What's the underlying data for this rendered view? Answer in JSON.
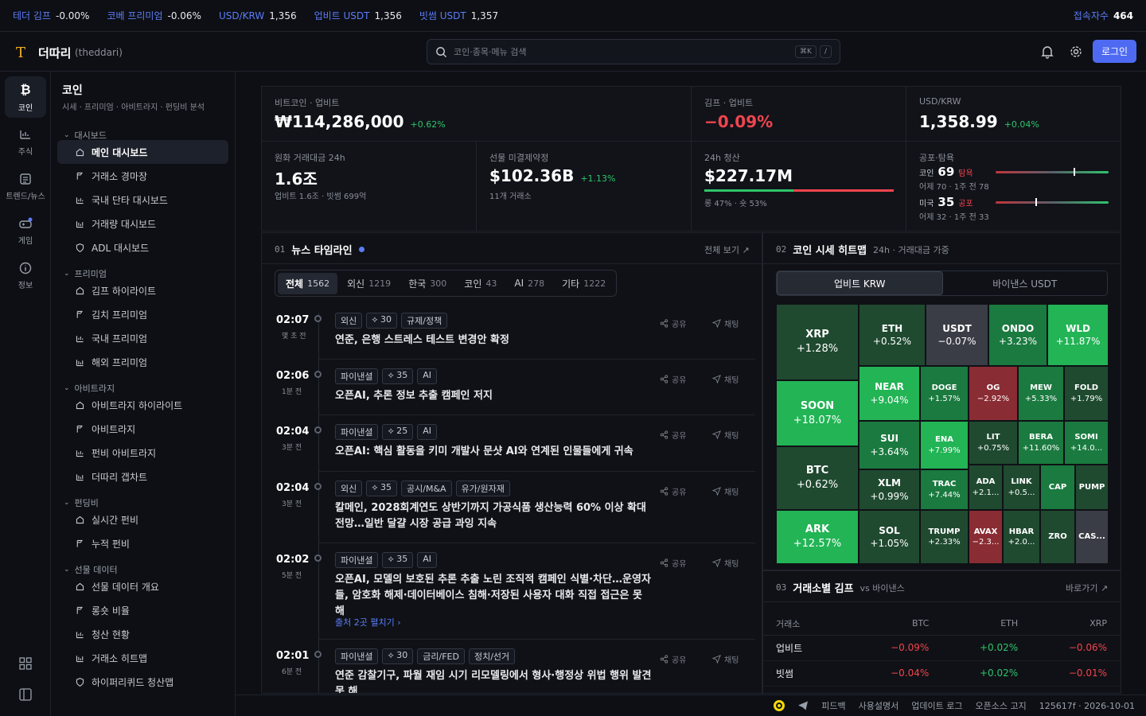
{
  "ticker": [
    {
      "label": "테더 김프",
      "value": "-0.00%"
    },
    {
      "label": "코베 프리미엄",
      "value": "-0.06%"
    },
    {
      "label": "USD/KRW",
      "value": "1,356"
    },
    {
      "label": "업비트 USDT",
      "value": "1,356"
    },
    {
      "label": "빗썸 USDT",
      "value": "1,357"
    }
  ],
  "online": {
    "label": "접속자수",
    "value": "464"
  },
  "header": {
    "logo": "T",
    "brand": "더따리",
    "brand_sub": "(theddari)",
    "search_placeholder": "코인·종목·메뉴 검색",
    "kbd1": "⌘K",
    "kbd2": "/",
    "login": "로그인"
  },
  "rail": [
    {
      "label": "코인",
      "icon": "bitcoin-icon"
    },
    {
      "label": "주식",
      "icon": "stock-icon"
    },
    {
      "label": "트렌드/뉴스",
      "icon": "news-icon"
    },
    {
      "label": "게임",
      "icon": "gamepad-icon"
    },
    {
      "label": "정보",
      "icon": "info-icon"
    }
  ],
  "sidebar": {
    "title": "코인",
    "subtitle": "시세 · 프리미엄 · 아비트라지 · 펀딩비 분석",
    "groups": [
      {
        "label": "대시보드",
        "items": [
          "메인 대시보드",
          "거래소 경마장",
          "국내 단타 대시보드",
          "거래량 대시보드",
          "ADL 대시보드"
        ]
      },
      {
        "label": "프리미엄",
        "items": [
          "김프 하이라이트",
          "김치 프리미엄",
          "국내 프리미엄",
          "해외 프리미엄"
        ]
      },
      {
        "label": "아비트라지",
        "items": [
          "아비트라지 하이라이트",
          "아비트라지",
          "펀비 아비트라지",
          "더따리 갭차트"
        ]
      },
      {
        "label": "펀딩비",
        "items": [
          "실시간 펀비",
          "누적 펀비"
        ]
      },
      {
        "label": "선물 데이터",
        "items": [
          "선물 데이터 개요",
          "롱숏 비율",
          "청산 현황",
          "거래소 히트맵",
          "하이퍼리퀴드 청산맵"
        ]
      }
    ]
  },
  "stats": {
    "btc": {
      "label": "비트코인 · 업비트",
      "value": "₩114,286,000",
      "change": "+0.62%"
    },
    "kimp": {
      "label": "김프 · 업비트",
      "value": "−0.09%"
    },
    "usdkrw": {
      "label": "USD/KRW",
      "value": "1,358.99",
      "change": "+0.04%"
    },
    "volume": {
      "label": "원화 거래대금 24h",
      "value": "1.6조",
      "sub": "업비트 1.6조 · 빗썸 699억"
    },
    "oi": {
      "label": "선물 미결제약정",
      "value": "$102.36B",
      "change": "+1.13%",
      "sub": "11개 거래소"
    },
    "liq": {
      "label": "24h 청산",
      "value": "$227.17M",
      "sub": "롱 47% · 숏 53%",
      "long_pct": 47
    },
    "fg": {
      "label": "공포·탐욕",
      "coin": {
        "name": "코인",
        "value": "69",
        "state": "탐욕",
        "sub": "어제 70 · 1주 전 78"
      },
      "us": {
        "name": "미국",
        "value": "35",
        "state": "공포",
        "sub": "어제 32 · 1주 전 33"
      }
    }
  },
  "news": {
    "num": "01",
    "title": "뉴스 타임라인",
    "link": "전체 보기 ↗",
    "filters": [
      {
        "label": "전체",
        "count": "1562"
      },
      {
        "label": "외신",
        "count": "1219"
      },
      {
        "label": "한국",
        "count": "300"
      },
      {
        "label": "코인",
        "count": "43"
      },
      {
        "label": "AI",
        "count": "278"
      },
      {
        "label": "기타",
        "count": "1222"
      }
    ],
    "share": "공유",
    "chat": "채팅",
    "items": [
      {
        "time": "02:07",
        "ago": "몇 초 전",
        "tags": [
          "외신",
          "⟡ 30",
          "규제/정책"
        ],
        "title": "연준, 은행 스트레스 테스트 변경안 확정"
      },
      {
        "time": "02:06",
        "ago": "1분 전",
        "tags": [
          "파이낸셜",
          "⟡ 35",
          "AI"
        ],
        "title": "오픈AI, 추론 정보 추출 캠페인 저지"
      },
      {
        "time": "02:04",
        "ago": "3분 전",
        "tags": [
          "파이낸셜",
          "⟡ 25",
          "AI"
        ],
        "title": "오픈AI: 핵심 활동을 키미 개발사 문샷 AI와 연계된 인물들에게 귀속"
      },
      {
        "time": "02:04",
        "ago": "3분 전",
        "tags": [
          "외신",
          "⟡ 35",
          "공시/M&A",
          "유가/원자재"
        ],
        "title": "칼메인, 2028회계연도 상반기까지 가공식품 생산능력 60% 이상 확대 전망…일반 달걀 시장 공급 과잉 지속"
      },
      {
        "time": "02:02",
        "ago": "5분 전",
        "tags": [
          "파이낸셜",
          "⟡ 35",
          "AI"
        ],
        "title": "오픈AI, 모델의 보호된 추론 추출 노린 조직적 캠페인 식별·차단…운영자들, 암호화 해제·데이터베이스 침해·저장된 사용자 대화 직접 접근은 못 해",
        "more": "출처 2곳 펼치기 ›"
      },
      {
        "time": "02:01",
        "ago": "6분 전",
        "tags": [
          "파이낸셜",
          "⟡ 30",
          "금리/FED",
          "정치/선거"
        ],
        "title": "연준 감찰기구, 파월 재임 시기 리모델링에서 형사·행정상 위법 행위 발견 못 해"
      }
    ]
  },
  "heatmap": {
    "num": "02",
    "title": "코인 시세 히트맵",
    "sub": "24h · 거래대금 가중",
    "tabs": [
      "업비트 KRW",
      "바이낸스 USDT"
    ],
    "cells": [
      {
        "sym": "XRP",
        "chg": "+1.28%"
      },
      {
        "sym": "ETH",
        "chg": "+0.52%"
      },
      {
        "sym": "USDT",
        "chg": "−0.07%"
      },
      {
        "sym": "ONDO",
        "chg": "+3.23%"
      },
      {
        "sym": "WLD",
        "chg": "+11.87%"
      },
      {
        "sym": "SOON",
        "chg": "+18.07%"
      },
      {
        "sym": "NEAR",
        "chg": "+9.04%"
      },
      {
        "sym": "DOGE",
        "chg": "+1.57%"
      },
      {
        "sym": "OG",
        "chg": "−2.92%"
      },
      {
        "sym": "MEW",
        "chg": "+5.33%"
      },
      {
        "sym": "FOLD",
        "chg": "+1.79%"
      },
      {
        "sym": "BTC",
        "chg": "+0.62%"
      },
      {
        "sym": "SUI",
        "chg": "+3.64%"
      },
      {
        "sym": "ENA",
        "chg": "+7.99%"
      },
      {
        "sym": "LIT",
        "chg": "+0.75%"
      },
      {
        "sym": "BERA",
        "chg": "+11.60%"
      },
      {
        "sym": "SOMI",
        "chg": "+14.0..."
      },
      {
        "sym": "XLM",
        "chg": "+0.99%"
      },
      {
        "sym": "TRAC",
        "chg": "+7.44%"
      },
      {
        "sym": "ADA",
        "chg": "+2.1..."
      },
      {
        "sym": "LINK",
        "chg": "+0.5..."
      },
      {
        "sym": "CAP",
        "chg": ""
      },
      {
        "sym": "PUMP",
        "chg": ""
      },
      {
        "sym": "ARK",
        "chg": "+12.57%"
      },
      {
        "sym": "SOL",
        "chg": "+1.05%"
      },
      {
        "sym": "TRUMP",
        "chg": "+2.33%"
      },
      {
        "sym": "AVAX",
        "chg": "−2.3..."
      },
      {
        "sym": "HBAR",
        "chg": "+2.0..."
      },
      {
        "sym": "ZRO",
        "chg": ""
      },
      {
        "sym": "CAS...",
        "chg": ""
      }
    ],
    "colors": {
      "strong": "#22b455",
      "mid": "#1a7a3f",
      "weak": "#1f4a30",
      "dim": "#223a2c",
      "red": "#8a2c33",
      "gray": "#3a3d45"
    }
  },
  "kimp": {
    "num": "03",
    "title": "거래소별 김프",
    "sub": "vs 바이낸스",
    "link": "바로가기 ↗",
    "headers": [
      "거래소",
      "BTC",
      "ETH",
      "XRP"
    ],
    "rows": [
      {
        "ex": "업비트",
        "btc": "−0.09%",
        "eth": "+0.02%",
        "xrp": "−0.06%"
      },
      {
        "ex": "빗썸",
        "btc": "−0.04%",
        "eth": "+0.02%",
        "xrp": "−0.01%"
      }
    ]
  },
  "footer": {
    "items": [
      "피드백",
      "사용설명서",
      "업데이트 로그",
      "오픈소스 고지"
    ],
    "build": "125617f · 2026-10-01"
  }
}
